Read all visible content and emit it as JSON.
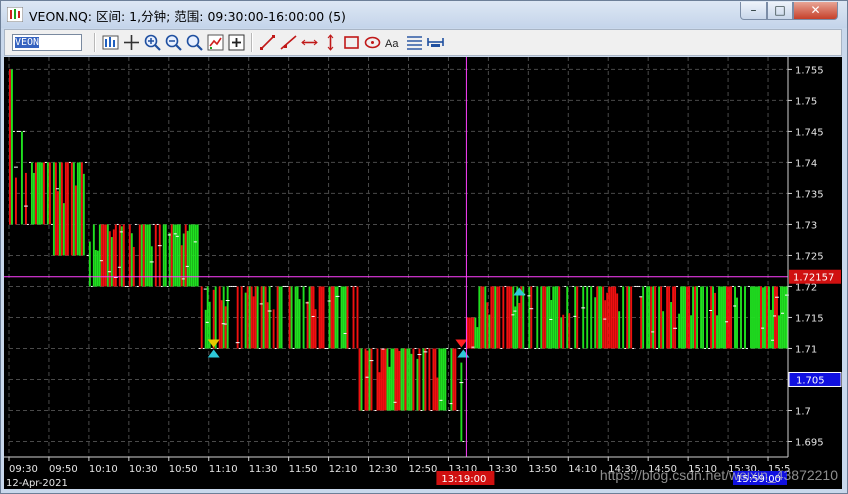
{
  "window": {
    "title": "VEON.NQ: 区间: 1,分钟; 范围: 09:30:00-16:00:00 (5)",
    "minimize_glyph": "–",
    "maximize_glyph": "□",
    "close_glyph": "✕"
  },
  "toolbar": {
    "symbol_value": "VEON",
    "buttons": [
      "bar-chart-icon",
      "crosshair-icon",
      "zoom-in-icon",
      "zoom-out-icon",
      "zoom-fit-icon",
      "indicator-icon",
      "add-icon",
      "line-tool-icon",
      "ray-tool-icon",
      "hline-tool-icon",
      "vline-tool-icon",
      "rectangle-tool-icon",
      "ellipse-tool-icon",
      "text-tool-icon",
      "fibonacci-icon",
      "measure-icon"
    ]
  },
  "chart_data": {
    "type": "bar",
    "ylim": [
      1.6925,
      1.757
    ],
    "y_ticks": [
      "1.755",
      "1.75",
      "1.745",
      "1.74",
      "1.735",
      "1.73",
      "1.725",
      "1.72",
      "1.715",
      "1.71",
      "1.705",
      "1.7",
      "1.695"
    ],
    "x_ticks": [
      "09:30",
      "09:50",
      "10:10",
      "10:30",
      "10:50",
      "11:10",
      "11:30",
      "11:50",
      "12:10",
      "12:30",
      "12:50",
      "13:10",
      "13:30",
      "13:50",
      "14:10",
      "14:30",
      "14:50",
      "15:10",
      "15:30",
      "15:5"
    ],
    "date_label": "12-Apr-2021",
    "crosshair_price": "1.72157",
    "crosshair_time": "13:19:00",
    "last_price": "1.705",
    "partial_time_label": "15:59:00",
    "watermark": "https://blog.csdn.net/weixin_43872210",
    "levels": [
      {
        "from": "09:30",
        "to": "09:32",
        "low": 1.73,
        "high": 1.755
      },
      {
        "from": "09:32",
        "to": "09:40",
        "low": 1.73,
        "high": 1.745
      },
      {
        "from": "09:40",
        "to": "09:52",
        "low": 1.73,
        "high": 1.74
      },
      {
        "from": "09:52",
        "to": "10:10",
        "low": 1.725,
        "high": 1.74
      },
      {
        "from": "10:10",
        "to": "11:05",
        "low": 1.72,
        "high": 1.73
      },
      {
        "from": "11:05",
        "to": "12:25",
        "low": 1.71,
        "high": 1.72
      },
      {
        "from": "12:25",
        "to": "13:15",
        "low": 1.7,
        "high": 1.71
      },
      {
        "from": "13:15",
        "to": "13:19",
        "low": 1.695,
        "high": 1.71
      },
      {
        "from": "13:19",
        "to": "13:25",
        "low": 1.71,
        "high": 1.715
      },
      {
        "from": "13:25",
        "to": "16:00",
        "low": 1.71,
        "high": 1.72
      }
    ],
    "markers": [
      {
        "time": "11:12",
        "price": 1.71,
        "kind": "down",
        "color": "#e8c800"
      },
      {
        "time": "11:12",
        "price": 1.71,
        "kind": "up",
        "color": "#2ec8d8"
      },
      {
        "time": "13:16",
        "price": 1.71,
        "kind": "down",
        "color": "#ff2020"
      },
      {
        "time": "13:17",
        "price": 1.71,
        "kind": "up",
        "color": "#2ec8d8"
      },
      {
        "time": "13:45",
        "price": 1.72,
        "kind": "up",
        "color": "#2ec8d8"
      }
    ],
    "grid": true,
    "colors": {
      "up": "#20e020",
      "down": "#f01010",
      "tick": "#ffffff",
      "grid": "#4a4a4a",
      "crosshair": "#ff40ff",
      "axis_text": "#e6e6e6"
    }
  }
}
